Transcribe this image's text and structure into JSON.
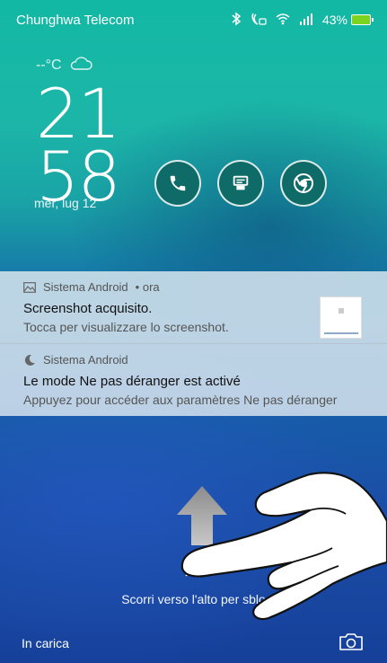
{
  "status_bar": {
    "carrier": "Chunghwa Telecom",
    "battery_percent": "43%"
  },
  "lockscreen": {
    "weather_temp": "--°C",
    "clock_hour": "21",
    "clock_minute": "58",
    "date": "mer, lug 12",
    "shortcuts": [
      {
        "icon": "phone-icon"
      },
      {
        "icon": "memo-icon"
      },
      {
        "icon": "chrome-icon"
      }
    ]
  },
  "notifications": [
    {
      "app": "Sistema Android",
      "time": "• ora",
      "title": "Screenshot acquisito.",
      "text": "Tocca per visualizzare lo screenshot."
    },
    {
      "app": "Sistema Android",
      "title": "Le mode Ne pas déranger est activé",
      "text": "Appuyez pour accéder aux paramètres Ne pas déranger"
    }
  ],
  "unlock_hint": "Scorri verso l'alto per sblo",
  "charging_status": "In carica",
  "colors": {
    "accent_teal": "#0f6b67",
    "battery_green": "#7ed321"
  }
}
